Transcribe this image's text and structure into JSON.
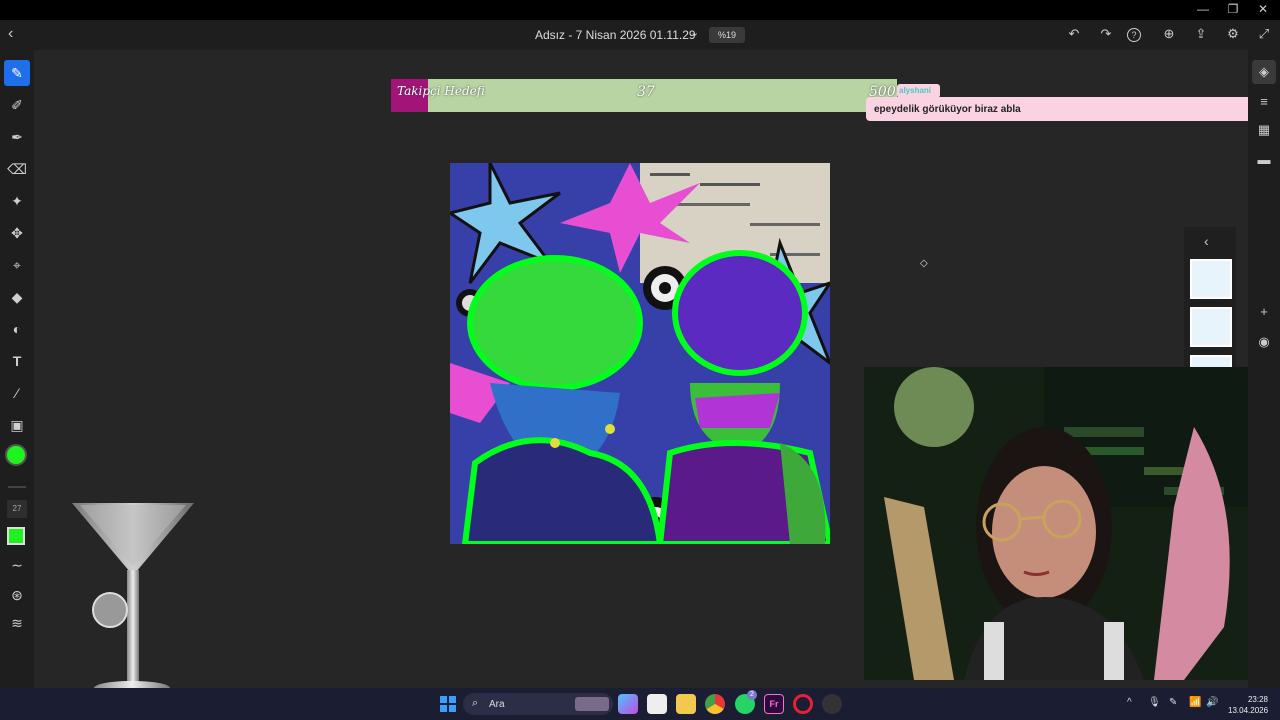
{
  "window": {
    "controls": {
      "minimize": "—",
      "restore": "❐",
      "close": "✕"
    }
  },
  "appbar": {
    "back_icon": "‹",
    "title": "Adsız - 7 Nisan 2026 01.11.29",
    "title_dropdown": "⌄",
    "zoom": "%19",
    "icons": {
      "undo": "↶",
      "redo": "↷",
      "help": "?",
      "account": "⊕",
      "share": "⇪",
      "settings": "⚙",
      "fullscreen": "⤢"
    }
  },
  "tools": {
    "items": [
      "✎",
      "✐",
      "✒",
      "⌫",
      "✦",
      "✥",
      "⌖",
      "◆",
      "◐",
      "T",
      "⁄",
      "▣"
    ],
    "brush_size": "27",
    "primary_color": "#1ef31e",
    "extra": [
      "∼",
      "⊛",
      "≋"
    ]
  },
  "right_panel": {
    "icons": [
      "◈",
      "≡",
      "▦",
      "▬",
      "+",
      "◉"
    ]
  },
  "overlay": {
    "goal_label": "Takipçi Hedefi",
    "goal_current": "37",
    "goal_target": "500",
    "goal_progress": 0.074,
    "goal_fill_color": "#b8d4a3",
    "goal_accent_color": "#a3147a",
    "chat_username": "alyshani",
    "chat_message": "epeydelik görüküyor biraz abla"
  },
  "layers": {
    "collapse_icon": "‹"
  },
  "taskbar": {
    "search_placeholder": "Ara",
    "notification_badge": "2",
    "tray_icons": [
      "^",
      "🎙",
      "✎",
      "📶",
      "🔊"
    ],
    "time": "23:28",
    "date": "13.04.2026"
  }
}
